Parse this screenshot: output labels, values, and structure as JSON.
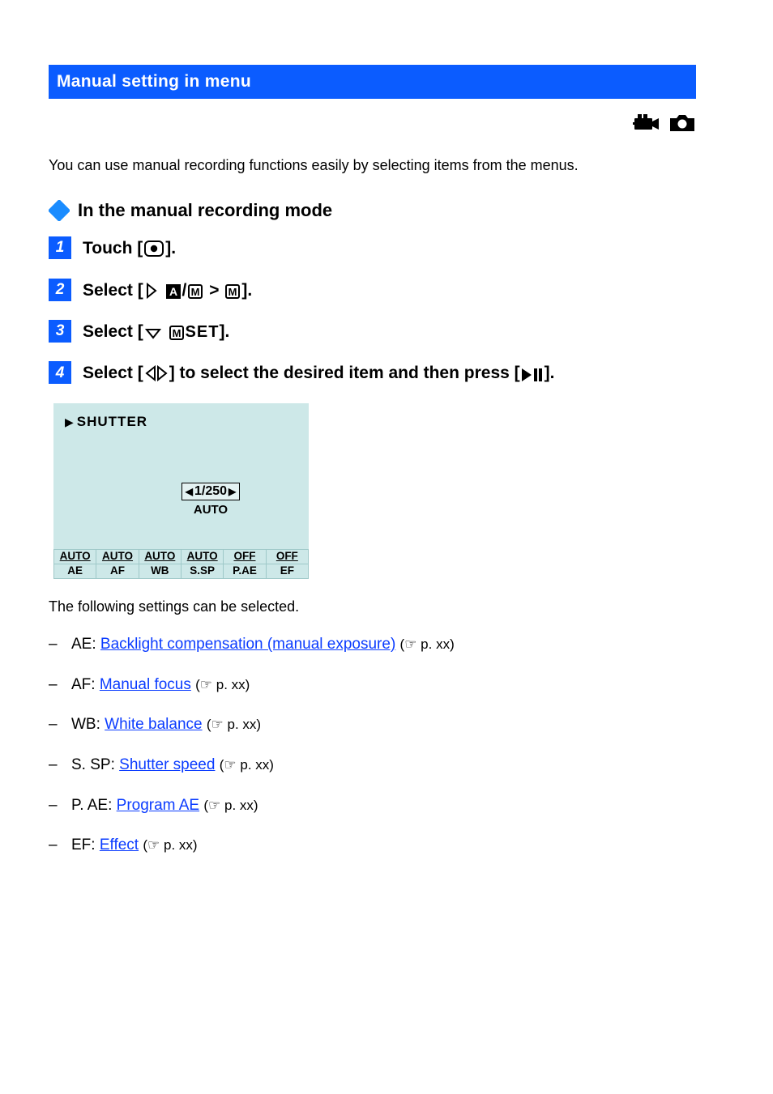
{
  "header": {
    "title": "Manual setting in menu"
  },
  "intro": "You can use manual recording functions easily by selecting items from the menus.",
  "lead_label": "In the manual recording mode",
  "steps": [
    {
      "n": "1",
      "before": "Touch [",
      "after": "]."
    },
    {
      "n": "2",
      "before": "Select [",
      "mid": " > ",
      "after": "]."
    },
    {
      "n": "3",
      "before": "Select [",
      "after": "]."
    },
    {
      "n": "4",
      "before": "Select [",
      "mid": "] to select the desired item and then press [",
      "after": "]."
    }
  ],
  "lcd": {
    "shutter": "SHUTTER",
    "value": "1/250",
    "auto": "AUTO",
    "cols_top": [
      "AUTO",
      "AUTO",
      "AUTO",
      "AUTO",
      "OFF",
      "OFF"
    ],
    "cols_bot": [
      "AE",
      "AF",
      "WB",
      "S.SP",
      "P.AE",
      "EF"
    ]
  },
  "settings_lead": "The following settings can be selected.",
  "settings": [
    {
      "b": "–",
      "label": "AE: ",
      "link": "Backlight compensation (manual exposure)",
      "ref": " (☞ p. xx)"
    },
    {
      "b": "–",
      "label": "AF: ",
      "link": "Manual focus",
      "ref": " (☞ p. xx)"
    },
    {
      "b": "–",
      "label": "WB: ",
      "link": "White balance",
      "ref": " (☞ p. xx)"
    },
    {
      "b": "–",
      "label": "S. SP: ",
      "link": "Shutter speed",
      "ref": " (☞ p. xx)"
    },
    {
      "b": "–",
      "label": "P. AE: ",
      "link": "Program AE",
      "ref": " (☞ p. xx)"
    },
    {
      "b": "–",
      "label": "EF: ",
      "link": "Effect",
      "ref": " (☞ p. xx)"
    }
  ]
}
